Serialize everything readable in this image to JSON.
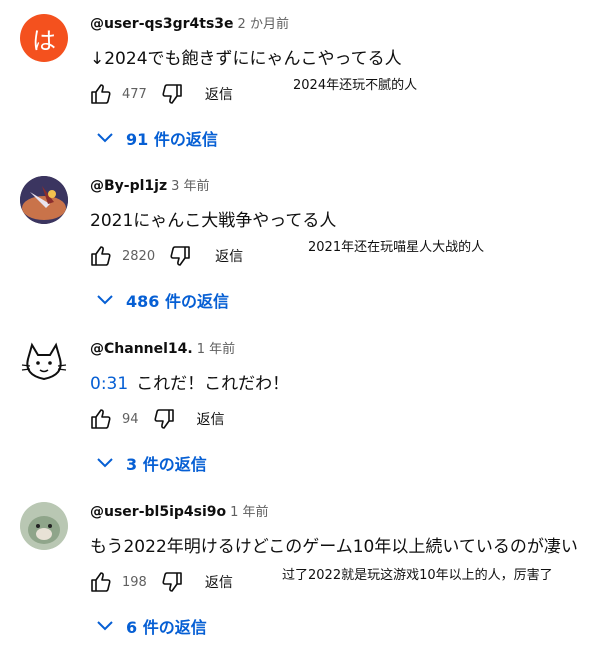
{
  "comments": [
    {
      "avatar_letter": "は",
      "author": "@user-qs3gr4ts3e",
      "time": "2 か月前",
      "text": "↓2024でも飽きずににゃんこやってる人",
      "timestamp_link": "",
      "likes": "477",
      "reply_label": "返信",
      "annotation": "2024年还玩不腻的人",
      "replies_label": "91 件の返信"
    },
    {
      "author": "@By-pl1jz",
      "time": "3 年前",
      "text": "2021にゃんこ大戦争やってる人",
      "timestamp_link": "",
      "likes": "2820",
      "reply_label": "返信",
      "annotation": "2021年还在玩喵星人大战的人",
      "replies_label": "486 件の返信"
    },
    {
      "author": "@Channel14.",
      "time": "1 年前",
      "text": "これだ！これだわ！",
      "timestamp_link": "0:31",
      "likes": "94",
      "reply_label": "返信",
      "annotation": "",
      "replies_label": "3 件の返信"
    },
    {
      "author": "@user-bl5ip4si9o",
      "time": "1 年前",
      "text": "もう2022年明けるけどこのゲーム10年以上続いているのが凄い",
      "timestamp_link": "",
      "likes": "198",
      "reply_label": "返信",
      "annotation": "过了2022就是玩这游戏10年以上的人，厉害了",
      "replies_label": "6 件の返信"
    }
  ],
  "colors": {
    "link_blue": "#065fd4",
    "avatar_orange": "#f4511e",
    "muted": "#606060"
  },
  "icons": [
    "thumb-up-icon",
    "thumb-down-icon",
    "chevron-down-icon"
  ]
}
